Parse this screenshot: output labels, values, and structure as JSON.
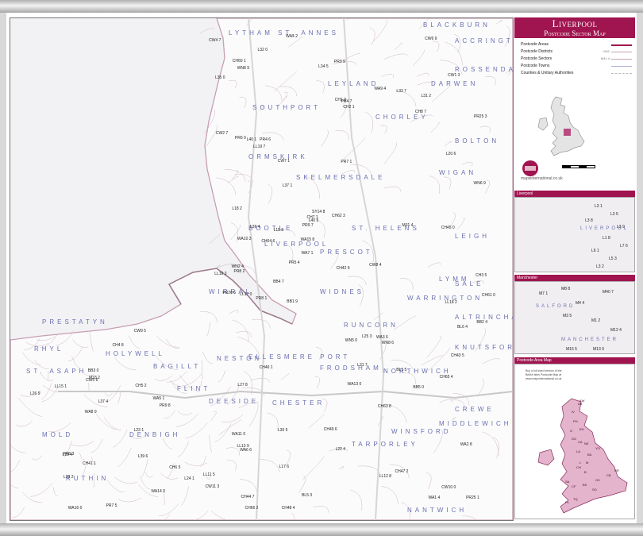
{
  "title": {
    "line1": "Liverpool",
    "line2": "Postcode Sector Map"
  },
  "legend": [
    {
      "label": "Postcode Areas",
      "sample": ""
    },
    {
      "label": "Postcode Districts",
      "sample": "M41"
    },
    {
      "label": "Postcode Sectors",
      "sample": "M41 4"
    },
    {
      "label": "Postcode Towns",
      "sample": ""
    },
    {
      "label": "Counties & Unitary Authorities",
      "sample": ""
    }
  ],
  "brand": {
    "name": "mapsinternational.co.uk"
  },
  "insets": [
    {
      "title": "Liverpool",
      "sectors": [
        "L3 1",
        "L3 5",
        "L3 8",
        "L3 9",
        "L1 8",
        "L7 6",
        "L6 1",
        "L5 3",
        "L3 2"
      ],
      "town": "LIVERPOOL"
    },
    {
      "title": "Manchester",
      "sectors": [
        "M8 8",
        "M7 1",
        "M40 7",
        "M4 4",
        "M3 5",
        "M1 2",
        "M12 4",
        "M15 5",
        "M13 9"
      ],
      "town": "SALFORD",
      "town2": "MANCHESTER"
    },
    {
      "title": "Postcode Area Map",
      "text": [
        "Buy a full sized version of the",
        "British Isles Postcode Map at",
        "www.mapsinternational.co.uk"
      ]
    }
  ],
  "towns": [
    "LYTHAM ST. ANNES",
    "SOUTHPORT",
    "ORMSKIRK",
    "SKELMERSDALE",
    "LEYLAND",
    "CHORLEY",
    "DARWEN",
    "BLACKBURN",
    "ACCRINGTON",
    "ROSSENDALE",
    "WIGAN",
    "BOLTON",
    "BOOTLE",
    "LIVERPOOL",
    "PRESCOT",
    "ST. HELENS",
    "WARRINGTON",
    "LEIGH",
    "WIRRAL",
    "PRESTATYN",
    "RHYL",
    "HOLYWELL",
    "ST. ASAPH",
    "DEESIDE",
    "CHESTER",
    "ELLESMERE PORT",
    "NESTON",
    "RUNCORN",
    "WIDNES",
    "FRODSHAM",
    "NORTHWICH",
    "KNUTSFORD",
    "MOLD",
    "DENBIGH",
    "RUTHIN",
    "TARPORLEY",
    "WINSFORD",
    "MIDDLEWICH",
    "CREWE",
    "NANTWICH",
    "FLINT",
    "BAGILLT",
    "LYMM",
    "ALTRINCHAM",
    "SALE"
  ],
  "sectors": [
    "PR8 1",
    "PR8 2",
    "PR8 3",
    "PR9 7",
    "PR9 8",
    "PR9 9",
    "PR4 6",
    "PR4 7",
    "PR5 4",
    "PR25 1",
    "PR25 3",
    "PR26 6",
    "PR7 1",
    "PR7 5",
    "PR6 0",
    "L37 1",
    "L37 4",
    "L39 2",
    "L39 6",
    "L40 1",
    "L40 5",
    "WN8 6",
    "WN8 9",
    "WN5 0",
    "WN6 9",
    "WN2 4",
    "WA11 0",
    "WA10 3",
    "WA9 4",
    "WA5 1",
    "WA1 4",
    "WA2 8",
    "WA3 6",
    "WA4 2",
    "WA13 0",
    "WA14 3",
    "WA15 8",
    "WA16 0",
    "WA6 6",
    "WA7 1",
    "WA8 9",
    "L20 6",
    "L21 7",
    "L22 4",
    "L23 1",
    "L30 5",
    "L31 2",
    "L32 0",
    "L33 7",
    "L34 5",
    "L35 0",
    "L36 4",
    "L26 9",
    "L27 8",
    "L24 1",
    "L25 3",
    "L19 4",
    "L18 2",
    "L17 6",
    "L15 9",
    "CH41 1",
    "CH42 9",
    "CH43 5",
    "CH44 7",
    "CH45 0",
    "CH46 1",
    "CH47 2",
    "CH48 4",
    "CH49 6",
    "CH60 1",
    "CH61 0",
    "CH62 3",
    "CH63 8",
    "CH64 6",
    "CH65 4",
    "CH66 2",
    "CH1 3",
    "CH2 1",
    "CH3 5",
    "CH4 8",
    "CH5 2",
    "CH6 5",
    "CH7 1",
    "CH8 7",
    "LL18 2",
    "LL19 7",
    "LL16 3",
    "LL15 1",
    "LL17 0",
    "CW1 3",
    "CW2 7",
    "CW4 7",
    "CW5 6",
    "CW6 9",
    "CW7 1",
    "CW8 4",
    "CW9 5",
    "CW10 0",
    "CW11 3",
    "M31 4",
    "M33 2",
    "BL5 3",
    "BL6 4",
    "BL1 5",
    "BB3 0",
    "BB2 4",
    "BB1 9",
    "BB5 0",
    "BB4 7",
    "SY14 8",
    "LL11 5",
    "LL12 8",
    "LL13 9"
  ],
  "area_map_regions": [
    "AB",
    "IV",
    "PH",
    "KW",
    "G",
    "EH",
    "DG",
    "CA",
    "NE",
    "LA",
    "BD",
    "YO",
    "M",
    "L",
    "CH",
    "B",
    "NR",
    "CB",
    "OX",
    "BS",
    "SO",
    "TQ",
    "PL",
    "CF",
    "SA"
  ],
  "colors": {
    "accent": "#a0144f",
    "town_label": "#6a6fb0",
    "sector_line": "#b89aab",
    "sea": "#e8e8ec"
  }
}
